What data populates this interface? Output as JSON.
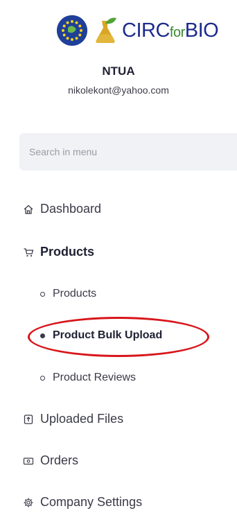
{
  "brand": {
    "logo_main": "CIRC",
    "logo_for": "for",
    "logo_end": "BIO"
  },
  "user": {
    "org": "NTUA",
    "email": "nikolekont@yahoo.com"
  },
  "search": {
    "placeholder": "Search in menu"
  },
  "menu": {
    "dashboard": "Dashboard",
    "products": "Products",
    "products_sub": [
      {
        "label": "Products",
        "active": false
      },
      {
        "label": "Product Bulk Upload",
        "active": true
      },
      {
        "label": "Product Reviews",
        "active": false
      }
    ],
    "uploaded_files": "Uploaded Files",
    "orders": "Orders",
    "company_settings": "Company Settings"
  },
  "colors": {
    "highlight": "#d8151a",
    "brand_blue": "#1d2a8c",
    "brand_green": "#3a8b2e"
  }
}
